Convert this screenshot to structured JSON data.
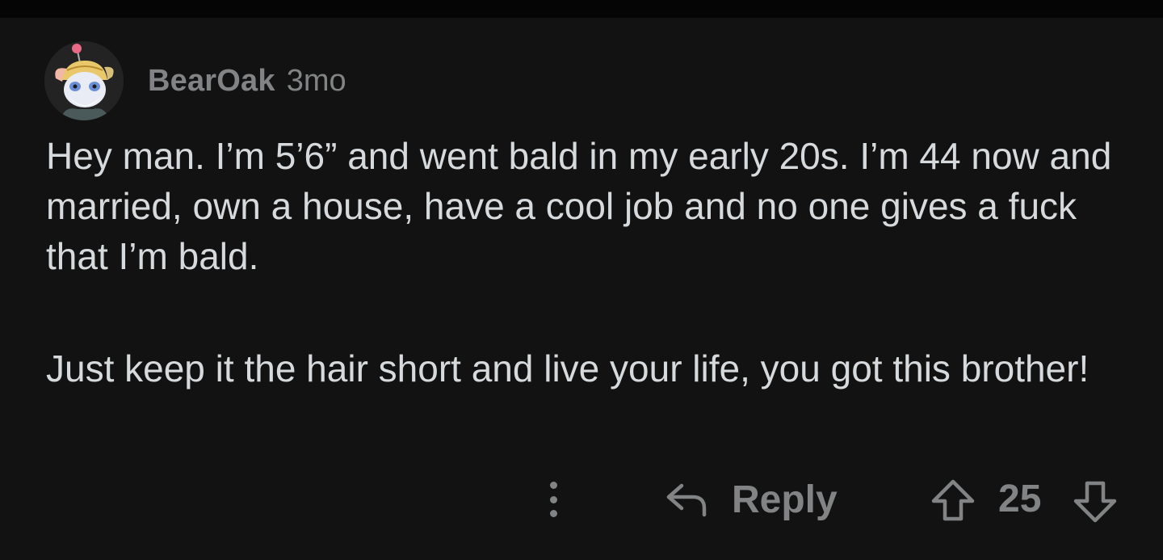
{
  "comment": {
    "username": "BearOak",
    "time": "3mo",
    "paragraphs": [
      "Hey man. I’m 5’6” and went bald in my early 20s. I’m 44 now and married, own a house, have a cool job and no one gives a fuck that I’m bald.",
      "Just keep it the hair short and live your life, you got this brother!"
    ]
  },
  "actions": {
    "more_icon": "more-vertical-icon",
    "reply_icon": "reply-arrow-icon",
    "reply_label": "Reply",
    "upvote_icon": "upvote-arrow-icon",
    "score": "25",
    "downvote_icon": "downvote-arrow-icon"
  },
  "colors": {
    "background": "#121212",
    "text": "#d7dadc",
    "muted": "#818384"
  }
}
